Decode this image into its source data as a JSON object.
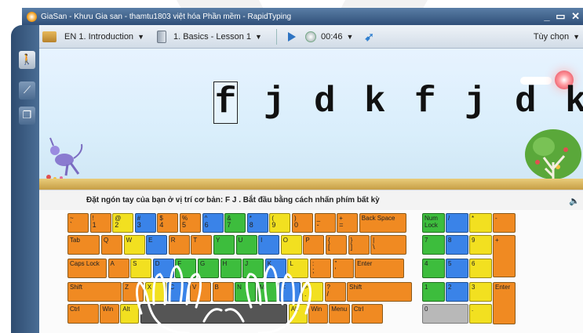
{
  "window": {
    "title": "GiaSan - Khưu Gia san - thamtu1803 việt hóa Phần mềm - RapidTyping",
    "controls": "_ ▭ ✕"
  },
  "toolbar": {
    "course": "EN 1. Introduction",
    "lesson": "1. Basics - Lesson 1",
    "timer": "00:46",
    "options": "Tùy chọn"
  },
  "sidebar": {
    "items": [
      {
        "icon": "walking-person-icon",
        "glyph": "🚶"
      },
      {
        "icon": "statistics-icon",
        "glyph": "📈"
      },
      {
        "icon": "lessons-icon",
        "glyph": "❐"
      }
    ]
  },
  "exercise": {
    "letters": [
      "f",
      "j",
      "d",
      "k",
      "f",
      "j",
      "d",
      "k"
    ],
    "current_index": 0
  },
  "instruction": "Đặt ngón tay của bạn ở vị trí cơ bản:  F J .  Bắt đầu bằng cách nhấn phím bất kỳ",
  "colors": {
    "pinky": "#f08a22",
    "ring": "#f2e020",
    "middle": "#3a83e8",
    "index": "#3dbd3d",
    "thumb": "#555555"
  },
  "keyboard": {
    "row1": [
      [
        "~",
        "`"
      ],
      [
        "!",
        "1"
      ],
      [
        "@",
        "2"
      ],
      [
        "#",
        "3"
      ],
      [
        "$",
        "4"
      ],
      [
        "%",
        "5"
      ],
      [
        "^",
        "6"
      ],
      [
        "&",
        "7"
      ],
      [
        "*",
        "8"
      ],
      [
        "(",
        "9"
      ],
      [
        ")",
        "0"
      ],
      [
        "_",
        "-"
      ],
      [
        "+",
        "="
      ],
      [
        "Back Space",
        ""
      ]
    ],
    "row2": [
      "Tab",
      "Q",
      "W",
      "E",
      "R",
      "T",
      "Y",
      "U",
      "I",
      "O",
      "P",
      [
        "{",
        "["
      ],
      [
        "}",
        "]"
      ],
      [
        "|",
        "\\"
      ]
    ],
    "row3": [
      "Caps Lock",
      "A",
      "S",
      "D",
      "F",
      "G",
      "H",
      "J",
      "K",
      "L",
      [
        ":",
        ";"
      ],
      [
        "\"",
        "'"
      ],
      "Enter"
    ],
    "row4": [
      "Shift",
      "Z",
      "X",
      "C",
      "V",
      "B",
      "N",
      "M",
      [
        "<",
        ","
      ],
      [
        ">",
        "."
      ],
      [
        "?",
        "/"
      ],
      "Shift"
    ],
    "row5": [
      "Ctrl",
      "Win",
      "Alt",
      "",
      "Alt",
      "Win",
      "Menu",
      "Ctrl"
    ],
    "numpad": [
      [
        "Num Lock",
        "/",
        "*",
        "-"
      ],
      [
        "7",
        "8",
        "9",
        "+"
      ],
      [
        "4",
        "5",
        "6"
      ],
      [
        "1",
        "2",
        "3",
        "Enter"
      ],
      [
        "0",
        "."
      ]
    ]
  }
}
